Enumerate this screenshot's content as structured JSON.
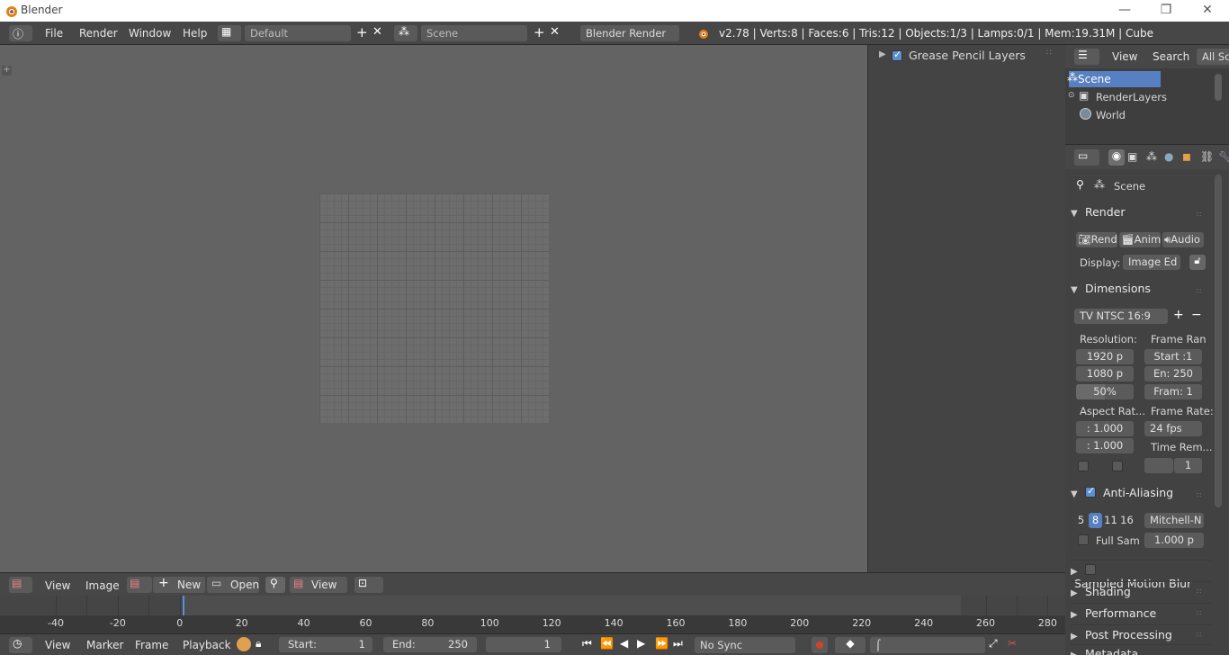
{
  "window": {
    "title": "Blender",
    "minimize": "—",
    "maximize": "❐",
    "close": "✕"
  },
  "info_header": {
    "menus": [
      "File",
      "Render",
      "Window",
      "Help"
    ],
    "screen_layout": "Default",
    "scene": "Scene",
    "engine": "Blender Render",
    "stats": "v2.78 | Verts:8 | Faces:6 | Tris:12 | Objects:1/3 | Lamps:0/1 | Mem:19.31M | Cube"
  },
  "grease_pencil": {
    "label": "Grease Pencil Layers",
    "checked": true
  },
  "image_editor_header": {
    "menus": [
      "View",
      "Image"
    ],
    "new_label": "New",
    "open_label": "Open",
    "view_label": "View"
  },
  "timeline": {
    "ticks": [
      "-40",
      "-20",
      "0",
      "20",
      "40",
      "60",
      "80",
      "100",
      "120",
      "140",
      "160",
      "180",
      "200",
      "220",
      "240",
      "260",
      "280"
    ],
    "header_menus": [
      "View",
      "Marker",
      "Frame",
      "Playback"
    ],
    "start_label": "Start:",
    "start_value": "1",
    "end_label": "End:",
    "end_value": "250",
    "current_frame": "1",
    "sync": "No Sync"
  },
  "outliner": {
    "header": {
      "view": "View",
      "search": "Search",
      "filter": "All Sc"
    },
    "items": [
      "Scene",
      "RenderLayers",
      "World"
    ]
  },
  "properties": {
    "context": "Scene",
    "render": {
      "title": "Render",
      "buttons": [
        "Rende",
        "Anima",
        "Audio"
      ],
      "display_label": "Display:",
      "display_value": "Image Ed"
    },
    "dimensions": {
      "title": "Dimensions",
      "preset": "TV NTSC 16:9",
      "resolution_label": "Resolution:",
      "res_x": "1920 p",
      "res_y": "1080 p",
      "res_pct": "50%",
      "frame_range_label": "Frame Ran",
      "start": "Start :1",
      "end": "En: 250",
      "step": "Fram: 1",
      "aspect_label": "Aspect Rat...",
      "aspect_x": ": 1.000",
      "aspect_y": ": 1.000",
      "frame_rate_label": "Frame Rate:",
      "fps": "24 fps",
      "time_remap_label": "Time Rem...",
      "time_remap_value": "1"
    },
    "anti_aliasing": {
      "title": "Anti-Aliasing",
      "checked": true,
      "samples": [
        "5",
        "8",
        "11",
        "16"
      ],
      "selected_sample": "8",
      "filter": "Mitchell-N",
      "full_sample_label": "Full Sam",
      "filter_size": "1.000 p"
    },
    "collapsed_panels": [
      "Sampled Motion Blur",
      "Shading",
      "Performance",
      "Post Processing",
      "Metadata"
    ]
  },
  "colors": {
    "accent": "#5680c2",
    "timeline_cursor": "#5690dc",
    "record": "#d0442a"
  }
}
